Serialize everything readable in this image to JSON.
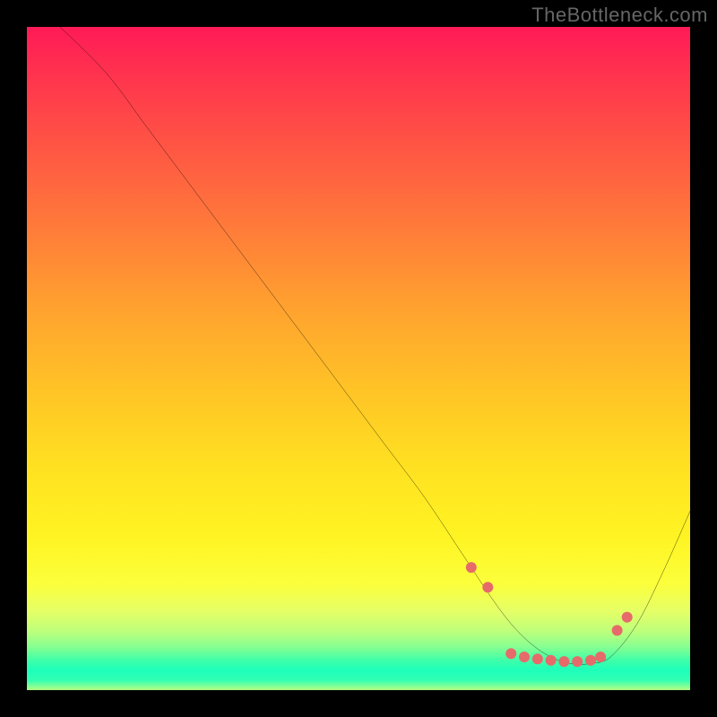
{
  "watermark": "TheBottleneck.com",
  "chart_data": {
    "type": "line",
    "title": "",
    "xlabel": "",
    "ylabel": "",
    "xlim": [
      0,
      100
    ],
    "ylim": [
      0,
      100
    ],
    "grid": false,
    "legend": false,
    "gradient_stops": [
      {
        "pos": 0,
        "color": "#ff1a57"
      },
      {
        "pos": 6,
        "color": "#ff2f4f"
      },
      {
        "pos": 18,
        "color": "#ff5544"
      },
      {
        "pos": 30,
        "color": "#ff7a3a"
      },
      {
        "pos": 42,
        "color": "#ffa12f"
      },
      {
        "pos": 55,
        "color": "#ffc426"
      },
      {
        "pos": 66,
        "color": "#ffe021"
      },
      {
        "pos": 77,
        "color": "#fff423"
      },
      {
        "pos": 84,
        "color": "#fbff3c"
      },
      {
        "pos": 88,
        "color": "#e6ff66"
      },
      {
        "pos": 91,
        "color": "#c0ff7a"
      },
      {
        "pos": 93.5,
        "color": "#86ff92"
      },
      {
        "pos": 95.5,
        "color": "#3fffa8"
      },
      {
        "pos": 97,
        "color": "#1dffbb"
      },
      {
        "pos": 98.5,
        "color": "#32ffb3"
      },
      {
        "pos": 100,
        "color": "#b5ff82"
      }
    ],
    "series": [
      {
        "name": "bottleneck-curve",
        "color": "#000000",
        "x": [
          5,
          12,
          18,
          24,
          30,
          36,
          42,
          48,
          54,
          60,
          66,
          70,
          73,
          76,
          79,
          82,
          85,
          88,
          92,
          96,
          100
        ],
        "y": [
          100,
          93,
          85,
          77,
          69,
          61,
          53,
          45,
          37,
          29,
          20,
          14,
          10,
          7,
          5,
          4,
          4,
          5,
          10,
          18,
          27
        ]
      }
    ],
    "markers": {
      "name": "highlight-points",
      "color": "#e76a6a",
      "radius": 6,
      "x": [
        67,
        69.5,
        73,
        75,
        77,
        79,
        81,
        83,
        85,
        86.5,
        89,
        90.5
      ],
      "y": [
        18.5,
        15.5,
        5.5,
        5,
        4.7,
        4.5,
        4.3,
        4.3,
        4.5,
        5,
        9,
        11
      ]
    }
  }
}
